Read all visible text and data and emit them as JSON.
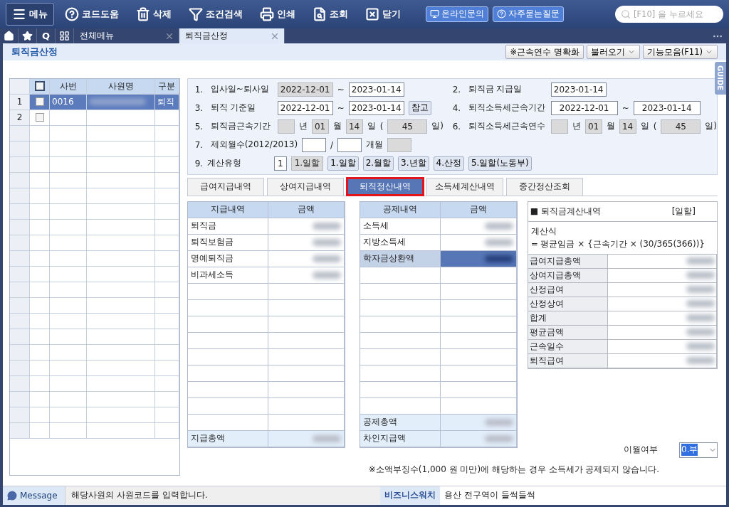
{
  "toolbar": {
    "buttons": [
      {
        "label": "메뉴",
        "kind": "menu"
      },
      {
        "label": "코드도움",
        "kind": "help"
      },
      {
        "label": "삭제",
        "kind": "delete"
      },
      {
        "label": "조건검색",
        "kind": "filter"
      },
      {
        "label": "인쇄",
        "kind": "print"
      },
      {
        "label": "조회",
        "kind": "lookup"
      },
      {
        "label": "닫기",
        "kind": "close"
      }
    ],
    "web_buttons": [
      {
        "label": "온라인문의",
        "kind": "monitor"
      },
      {
        "label": "자주묻는질문",
        "kind": "faq"
      }
    ],
    "search": {
      "placeholder": "[F10] 을 누르세요"
    }
  },
  "tab_bar": {
    "quick": [
      {
        "kind": "home"
      },
      {
        "kind": "star"
      },
      {
        "kind": "text",
        "label": "Q"
      },
      {
        "kind": "grid"
      }
    ],
    "tabs": [
      {
        "label": "전체메뉴",
        "selected": false
      },
      {
        "label": "퇴직금산정",
        "selected": true
      }
    ]
  },
  "page": {
    "title": "퇴직금산정",
    "buttons": [
      {
        "label": "※근속연수 명확화",
        "dropdown": false
      },
      {
        "label": "불러오기",
        "dropdown": true
      },
      {
        "label": "기능모음(F11)",
        "dropdown": true
      }
    ],
    "guide": "GUIDE"
  },
  "employee_grid": {
    "select_all": {
      "checked": false
    },
    "columns": [
      "사번",
      "사원명",
      "구분"
    ],
    "rows": [
      {
        "no": "1",
        "checked": false,
        "code": "0016",
        "type": "퇴직",
        "selected": true
      },
      {
        "no": "2",
        "checked": false,
        "selected": false
      }
    ]
  },
  "form": [
    {
      "left": [
        {
          "kind": "num",
          "text": "1."
        },
        {
          "kind": "label",
          "text": "입사일~퇴사일"
        },
        {
          "kind": "date",
          "value": "2022-12-01",
          "readonly": true
        },
        {
          "kind": "text",
          "text": "~"
        },
        {
          "kind": "date",
          "value": "2023-01-14",
          "readonly": false
        }
      ],
      "right": [
        {
          "kind": "num",
          "text": "2."
        },
        {
          "kind": "label",
          "text": "퇴직금 지급일"
        },
        {
          "kind": "date",
          "value": "2023-01-14",
          "readonly": false
        }
      ]
    },
    {
      "left": [
        {
          "kind": "num",
          "text": "3."
        },
        {
          "kind": "label",
          "text": "퇴직 기준일"
        },
        {
          "kind": "date",
          "value": "2022-12-01",
          "readonly": false
        },
        {
          "kind": "text",
          "text": "~"
        },
        {
          "kind": "date",
          "value": "2023-01-14",
          "readonly": false
        },
        {
          "kind": "button",
          "text": "참고"
        }
      ],
      "right": [
        {
          "kind": "num",
          "text": "4."
        },
        {
          "kind": "label",
          "text": "퇴직소득세근속기간"
        },
        {
          "kind": "wide",
          "value": "2022-12-01",
          "readonly": false
        },
        {
          "kind": "text",
          "text": "~"
        },
        {
          "kind": "wide",
          "value": "2023-01-14",
          "readonly": false
        }
      ]
    },
    {
      "left": [
        {
          "kind": "num",
          "text": "5."
        },
        {
          "kind": "label",
          "text": "퇴직금근속기간"
        },
        {
          "kind": "box",
          "readonly": true
        },
        {
          "kind": "text",
          "text": "년"
        },
        {
          "kind": "box",
          "value": "01",
          "readonly": true
        },
        {
          "kind": "text",
          "text": "월"
        },
        {
          "kind": "box",
          "value": "14",
          "readonly": true
        },
        {
          "kind": "text",
          "text": "일"
        },
        {
          "kind": "text",
          "text": "("
        },
        {
          "kind": "count",
          "value": "45",
          "readonly": true
        },
        {
          "kind": "text",
          "text": "일)"
        }
      ],
      "right": [
        {
          "kind": "num",
          "text": "6."
        },
        {
          "kind": "label",
          "text": "퇴직소득세근속연수"
        },
        {
          "kind": "box",
          "readonly": true
        },
        {
          "kind": "text",
          "text": "년"
        },
        {
          "kind": "box",
          "value": "01",
          "readonly": true
        },
        {
          "kind": "text",
          "text": "월"
        },
        {
          "kind": "box",
          "value": "14",
          "readonly": true
        },
        {
          "kind": "text",
          "text": "일"
        },
        {
          "kind": "text",
          "text": "("
        },
        {
          "kind": "count",
          "value": "45",
          "readonly": true
        },
        {
          "kind": "text",
          "text": "일)"
        }
      ]
    },
    {
      "left": [
        {
          "kind": "num",
          "text": "7."
        },
        {
          "kind": "label",
          "text": "제외월수(2012/2013)"
        },
        {
          "kind": "slot",
          "readonly": false
        },
        {
          "kind": "text",
          "text": "/"
        },
        {
          "kind": "slot",
          "readonly": false
        },
        {
          "kind": "text",
          "text": "개월"
        },
        {
          "kind": "slot",
          "readonly": true
        }
      ]
    },
    {
      "left": [
        {
          "kind": "num",
          "text": "9."
        },
        {
          "kind": "label",
          "text": "계산유형"
        },
        {
          "kind": "box",
          "value": "1",
          "readonly": false
        },
        {
          "kind": "choice",
          "value": "1.일할",
          "readonly": true
        },
        {
          "kind": "button",
          "text": "1.일할"
        },
        {
          "kind": "button",
          "text": "2.월할"
        },
        {
          "kind": "button",
          "text": "3.년할"
        },
        {
          "kind": "button",
          "text": "4.산정"
        },
        {
          "kind": "button",
          "text": "5.일할(노동부)"
        }
      ]
    }
  ],
  "sub_tabs": [
    {
      "label": "급여지급내역",
      "selected": false,
      "highlighted": false
    },
    {
      "label": "상여지급내역",
      "selected": false,
      "highlighted": false
    },
    {
      "label": "퇴직정산내역",
      "selected": true,
      "highlighted": true
    },
    {
      "label": "소득세계산내역",
      "selected": false,
      "highlighted": false
    },
    {
      "label": "중간정산조회",
      "selected": false,
      "highlighted": false
    }
  ],
  "payment_table": {
    "columns": [
      "지급내역",
      "금액"
    ],
    "rows": [
      {
        "label": "퇴직금",
        "selected": false
      },
      {
        "label": "퇴직보험금",
        "selected": false
      },
      {
        "label": "명예퇴직금",
        "selected": false
      },
      {
        "label": "비과세소득",
        "selected": false
      }
    ],
    "footer": [
      "지급총액"
    ]
  },
  "deduction_table": {
    "columns": [
      "공제내역",
      "금액"
    ],
    "rows": [
      {
        "label": "소득세",
        "selected": false
      },
      {
        "label": "지방소득세",
        "selected": false
      },
      {
        "label": "학자금상환액",
        "selected": true
      }
    ],
    "footer": [
      "공제총액",
      "차인지급액"
    ]
  },
  "calc_panel": {
    "title": "■ 퇴직금계산내역",
    "mode": "[일할]",
    "formula": [
      "계산식",
      "= 평균임금 × {근속기간 × (30/365(366))}"
    ],
    "rows": [
      "급여지급총액",
      "상여지급총액",
      "산정급여",
      "산정상여",
      "합계",
      "평균금액",
      "근속일수",
      "퇴직급여"
    ]
  },
  "carryover": {
    "label": "이월여부",
    "value": "0.부"
  },
  "note": "※소액부징수(1,000 원 미만)에 해당하는 경우 소득세가 공제되지 않습니다.",
  "status_bar": {
    "label": "Message",
    "message": "해당사원의 사원코드를 입력합니다.",
    "news_label": "비즈니스워치",
    "news": "용산 전구역이 들썩들썩"
  }
}
